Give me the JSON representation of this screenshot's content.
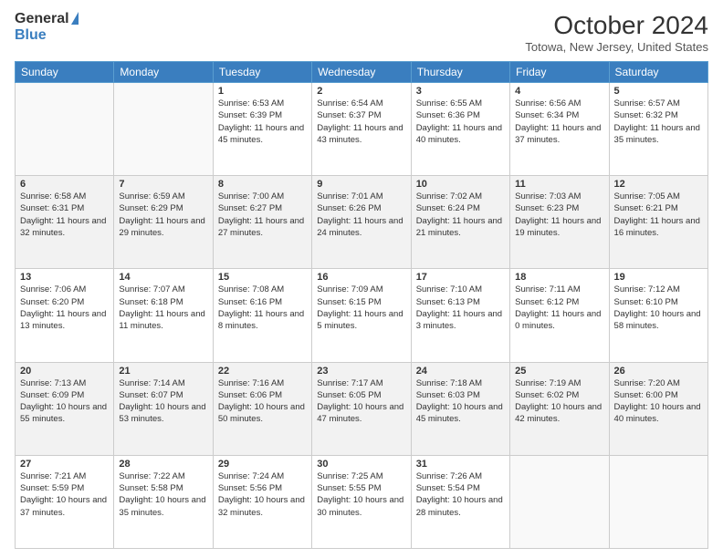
{
  "logo": {
    "general": "General",
    "blue": "Blue"
  },
  "header": {
    "month": "October 2024",
    "location": "Totowa, New Jersey, United States"
  },
  "days_of_week": [
    "Sunday",
    "Monday",
    "Tuesday",
    "Wednesday",
    "Thursday",
    "Friday",
    "Saturday"
  ],
  "weeks": [
    [
      {
        "day": null,
        "sunrise": "",
        "sunset": "",
        "daylight": ""
      },
      {
        "day": null,
        "sunrise": "",
        "sunset": "",
        "daylight": ""
      },
      {
        "day": "1",
        "sunrise": "Sunrise: 6:53 AM",
        "sunset": "Sunset: 6:39 PM",
        "daylight": "Daylight: 11 hours and 45 minutes."
      },
      {
        "day": "2",
        "sunrise": "Sunrise: 6:54 AM",
        "sunset": "Sunset: 6:37 PM",
        "daylight": "Daylight: 11 hours and 43 minutes."
      },
      {
        "day": "3",
        "sunrise": "Sunrise: 6:55 AM",
        "sunset": "Sunset: 6:36 PM",
        "daylight": "Daylight: 11 hours and 40 minutes."
      },
      {
        "day": "4",
        "sunrise": "Sunrise: 6:56 AM",
        "sunset": "Sunset: 6:34 PM",
        "daylight": "Daylight: 11 hours and 37 minutes."
      },
      {
        "day": "5",
        "sunrise": "Sunrise: 6:57 AM",
        "sunset": "Sunset: 6:32 PM",
        "daylight": "Daylight: 11 hours and 35 minutes."
      }
    ],
    [
      {
        "day": "6",
        "sunrise": "Sunrise: 6:58 AM",
        "sunset": "Sunset: 6:31 PM",
        "daylight": "Daylight: 11 hours and 32 minutes."
      },
      {
        "day": "7",
        "sunrise": "Sunrise: 6:59 AM",
        "sunset": "Sunset: 6:29 PM",
        "daylight": "Daylight: 11 hours and 29 minutes."
      },
      {
        "day": "8",
        "sunrise": "Sunrise: 7:00 AM",
        "sunset": "Sunset: 6:27 PM",
        "daylight": "Daylight: 11 hours and 27 minutes."
      },
      {
        "day": "9",
        "sunrise": "Sunrise: 7:01 AM",
        "sunset": "Sunset: 6:26 PM",
        "daylight": "Daylight: 11 hours and 24 minutes."
      },
      {
        "day": "10",
        "sunrise": "Sunrise: 7:02 AM",
        "sunset": "Sunset: 6:24 PM",
        "daylight": "Daylight: 11 hours and 21 minutes."
      },
      {
        "day": "11",
        "sunrise": "Sunrise: 7:03 AM",
        "sunset": "Sunset: 6:23 PM",
        "daylight": "Daylight: 11 hours and 19 minutes."
      },
      {
        "day": "12",
        "sunrise": "Sunrise: 7:05 AM",
        "sunset": "Sunset: 6:21 PM",
        "daylight": "Daylight: 11 hours and 16 minutes."
      }
    ],
    [
      {
        "day": "13",
        "sunrise": "Sunrise: 7:06 AM",
        "sunset": "Sunset: 6:20 PM",
        "daylight": "Daylight: 11 hours and 13 minutes."
      },
      {
        "day": "14",
        "sunrise": "Sunrise: 7:07 AM",
        "sunset": "Sunset: 6:18 PM",
        "daylight": "Daylight: 11 hours and 11 minutes."
      },
      {
        "day": "15",
        "sunrise": "Sunrise: 7:08 AM",
        "sunset": "Sunset: 6:16 PM",
        "daylight": "Daylight: 11 hours and 8 minutes."
      },
      {
        "day": "16",
        "sunrise": "Sunrise: 7:09 AM",
        "sunset": "Sunset: 6:15 PM",
        "daylight": "Daylight: 11 hours and 5 minutes."
      },
      {
        "day": "17",
        "sunrise": "Sunrise: 7:10 AM",
        "sunset": "Sunset: 6:13 PM",
        "daylight": "Daylight: 11 hours and 3 minutes."
      },
      {
        "day": "18",
        "sunrise": "Sunrise: 7:11 AM",
        "sunset": "Sunset: 6:12 PM",
        "daylight": "Daylight: 11 hours and 0 minutes."
      },
      {
        "day": "19",
        "sunrise": "Sunrise: 7:12 AM",
        "sunset": "Sunset: 6:10 PM",
        "daylight": "Daylight: 10 hours and 58 minutes."
      }
    ],
    [
      {
        "day": "20",
        "sunrise": "Sunrise: 7:13 AM",
        "sunset": "Sunset: 6:09 PM",
        "daylight": "Daylight: 10 hours and 55 minutes."
      },
      {
        "day": "21",
        "sunrise": "Sunrise: 7:14 AM",
        "sunset": "Sunset: 6:07 PM",
        "daylight": "Daylight: 10 hours and 53 minutes."
      },
      {
        "day": "22",
        "sunrise": "Sunrise: 7:16 AM",
        "sunset": "Sunset: 6:06 PM",
        "daylight": "Daylight: 10 hours and 50 minutes."
      },
      {
        "day": "23",
        "sunrise": "Sunrise: 7:17 AM",
        "sunset": "Sunset: 6:05 PM",
        "daylight": "Daylight: 10 hours and 47 minutes."
      },
      {
        "day": "24",
        "sunrise": "Sunrise: 7:18 AM",
        "sunset": "Sunset: 6:03 PM",
        "daylight": "Daylight: 10 hours and 45 minutes."
      },
      {
        "day": "25",
        "sunrise": "Sunrise: 7:19 AM",
        "sunset": "Sunset: 6:02 PM",
        "daylight": "Daylight: 10 hours and 42 minutes."
      },
      {
        "day": "26",
        "sunrise": "Sunrise: 7:20 AM",
        "sunset": "Sunset: 6:00 PM",
        "daylight": "Daylight: 10 hours and 40 minutes."
      }
    ],
    [
      {
        "day": "27",
        "sunrise": "Sunrise: 7:21 AM",
        "sunset": "Sunset: 5:59 PM",
        "daylight": "Daylight: 10 hours and 37 minutes."
      },
      {
        "day": "28",
        "sunrise": "Sunrise: 7:22 AM",
        "sunset": "Sunset: 5:58 PM",
        "daylight": "Daylight: 10 hours and 35 minutes."
      },
      {
        "day": "29",
        "sunrise": "Sunrise: 7:24 AM",
        "sunset": "Sunset: 5:56 PM",
        "daylight": "Daylight: 10 hours and 32 minutes."
      },
      {
        "day": "30",
        "sunrise": "Sunrise: 7:25 AM",
        "sunset": "Sunset: 5:55 PM",
        "daylight": "Daylight: 10 hours and 30 minutes."
      },
      {
        "day": "31",
        "sunrise": "Sunrise: 7:26 AM",
        "sunset": "Sunset: 5:54 PM",
        "daylight": "Daylight: 10 hours and 28 minutes."
      },
      {
        "day": null,
        "sunrise": "",
        "sunset": "",
        "daylight": ""
      },
      {
        "day": null,
        "sunrise": "",
        "sunset": "",
        "daylight": ""
      }
    ]
  ]
}
